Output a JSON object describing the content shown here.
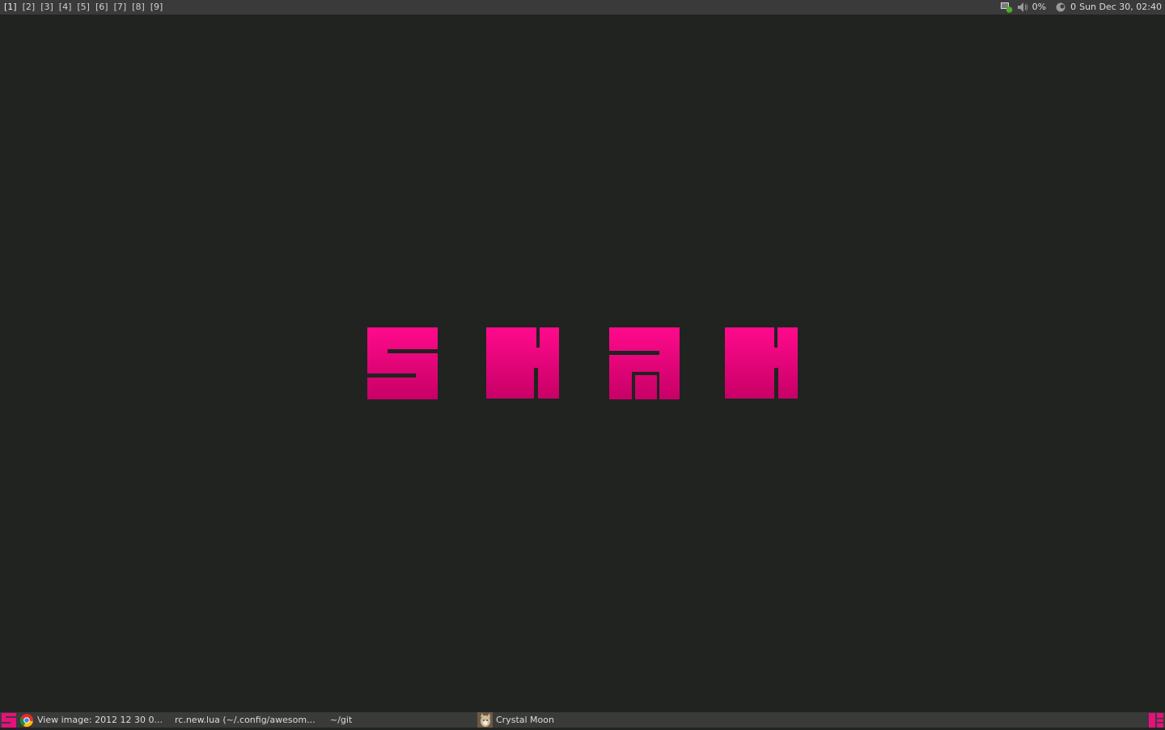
{
  "topbar": {
    "tags": [
      "[1]",
      "[2]",
      "[3]",
      "[4]",
      "[5]",
      "[6]",
      "[7]",
      "[8]",
      "[9]"
    ],
    "active_tag": 0,
    "tray": {
      "network_icon": "network-connected-icon",
      "volume_icon": "speaker-icon",
      "volume_text": "0%",
      "mail_icon": "mail-icon",
      "mail_count": "0",
      "clock": "Sun Dec 30, 02:40"
    }
  },
  "desktop": {
    "logo_text": "SHAH",
    "logo_color_top": "#ff0a8c",
    "logo_color_bottom": "#c70066"
  },
  "tasklist": {
    "tasks": [
      {
        "icon": "chrome-icon",
        "label": "View image: 2012 12 30 0..."
      },
      {
        "icon": "",
        "label": "rc.new.lua (~/.config/awesom..."
      },
      {
        "icon": "",
        "label": "~/git"
      },
      {
        "icon": "cat-avatar-icon",
        "label": "Crystal Moon"
      }
    ]
  },
  "colors": {
    "bar_bg": "#3a3a3a",
    "desktop_bg": "#202320",
    "accent": "#e8107a"
  }
}
